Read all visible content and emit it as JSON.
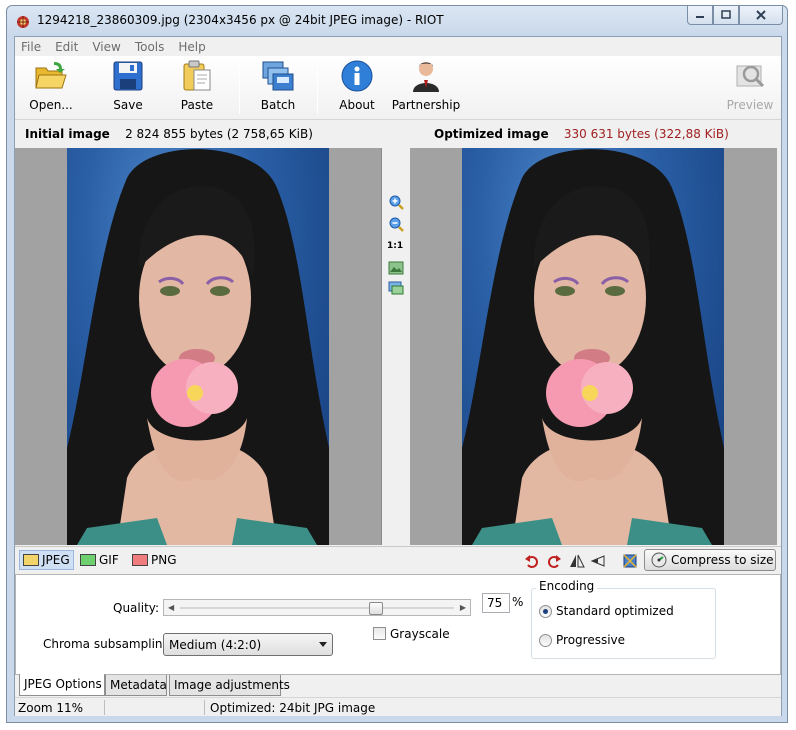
{
  "window": {
    "title": "1294218_23860309.jpg (2304x3456 px @ 24bit JPEG image) - RIOT"
  },
  "menu": {
    "items": [
      "File",
      "Edit",
      "View",
      "Tools",
      "Help"
    ]
  },
  "toolbar": {
    "open_label": "Open...",
    "save_label": "Save",
    "paste_label": "Paste",
    "batch_label": "Batch",
    "about_label": "About",
    "partnership_label": "Partnership",
    "preview_label": "Preview"
  },
  "info": {
    "initial_label": "Initial image",
    "initial_size": "2 824 855 bytes (2 758,65 KiB)",
    "optimized_label": "Optimized image",
    "optimized_size": "330 631 bytes (322,88 KiB)",
    "optimized_color": "#a02020"
  },
  "zoom": {
    "one_to_one": "1:1"
  },
  "formats": {
    "tabs": [
      "JPEG",
      "GIF",
      "PNG"
    ],
    "active": "JPEG",
    "compress_label": "Compress to size"
  },
  "jpeg_options": {
    "quality_label": "Quality:",
    "quality_value": "75",
    "quality_unit": "%",
    "chroma_label": "Chroma subsampling:",
    "chroma_value": "Medium (4:2:0)",
    "grayscale_label": "Grayscale",
    "grayscale_checked": false,
    "encoding_title": "Encoding",
    "encoding_options": [
      "Standard optimized",
      "Progressive"
    ],
    "encoding_selected": "Standard optimized"
  },
  "bottom_tabs": [
    "JPEG Options",
    "Metadata",
    "Image adjustments"
  ],
  "status": {
    "zoom": "Zoom 11%",
    "middle": "",
    "optimized": "Optimized: 24bit JPG image"
  }
}
